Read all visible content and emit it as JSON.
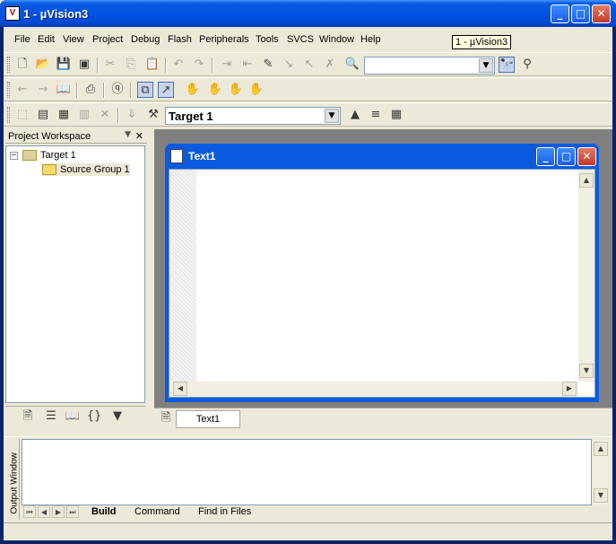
{
  "window": {
    "title": "1  - µVision3",
    "app_icon": "uvision-app-icon"
  },
  "menu": [
    "File",
    "Edit",
    "View",
    "Project",
    "Debug",
    "Flash",
    "Peripherals",
    "Tools",
    "SVCS",
    "Window",
    "Help"
  ],
  "tooltip": "1  - µVision3",
  "toolbar": {
    "find_combo_value": "",
    "target_combo_value": "Target 1"
  },
  "workspace": {
    "title": "Project Workspace",
    "tree": {
      "target": "Target 1",
      "group": "Source Group 1"
    },
    "tabs": [
      "files-tab-icon",
      "regs-tab-icon",
      "books-tab-icon",
      "functions-tab-icon",
      "templates-tab-icon"
    ]
  },
  "editor": {
    "title": "Text1",
    "content": ""
  },
  "doc_tabs": [
    "Text1"
  ],
  "output": {
    "label": "Output Window",
    "tabs": [
      "Build",
      "Command",
      "Find in Files"
    ],
    "active_tab": "Build",
    "content": ""
  },
  "colors": {
    "titlebar": "#0054e3",
    "face": "#ece9d8",
    "mdi_bg": "#808080"
  }
}
